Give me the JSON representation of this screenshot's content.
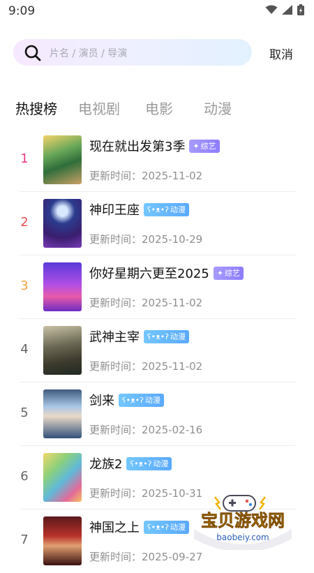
{
  "status_bar": {
    "time": "9:09"
  },
  "search": {
    "placeholder": "片名 / 演员 / 导演",
    "cancel_label": "取消"
  },
  "tabs": [
    {
      "label": "热搜榜",
      "active": true
    },
    {
      "label": "电视剧",
      "active": false
    },
    {
      "label": "电影",
      "active": false
    },
    {
      "label": "动漫",
      "active": false
    }
  ],
  "rank_colors": [
    "#e23c84",
    "#f05050",
    "#f1a540",
    "#666666"
  ],
  "items": [
    {
      "rank": "1",
      "title": "现在就出发第3季",
      "tag": "综艺",
      "tag_type": "variety",
      "updated_prefix": "更新时间：",
      "updated": "2025-11-02"
    },
    {
      "rank": "2",
      "title": "神印王座",
      "tag": "动漫",
      "tag_type": "anime",
      "updated_prefix": "更新时间：",
      "updated": "2025-10-29"
    },
    {
      "rank": "3",
      "title": "你好星期六更至2025",
      "tag": "综艺",
      "tag_type": "variety",
      "updated_prefix": "更新时间：",
      "updated": "2025-11-02"
    },
    {
      "rank": "4",
      "title": "武神主宰",
      "tag": "动漫",
      "tag_type": "anime",
      "updated_prefix": "更新时间：",
      "updated": "2025-11-02"
    },
    {
      "rank": "5",
      "title": "剑来",
      "tag": "动漫",
      "tag_type": "anime",
      "updated_prefix": "更新时间：",
      "updated": "2025-02-16"
    },
    {
      "rank": "6",
      "title": "龙族2",
      "tag": "动漫",
      "tag_type": "anime",
      "updated_prefix": "更新时间：",
      "updated": "2025-10-31"
    },
    {
      "rank": "7",
      "title": "神国之上",
      "tag": "动漫",
      "tag_type": "anime",
      "updated_prefix": "更新时间：",
      "updated": "2025-09-27"
    }
  ],
  "watermark": {
    "name": "宝贝游戏网",
    "domain": "baobeiy.com"
  }
}
